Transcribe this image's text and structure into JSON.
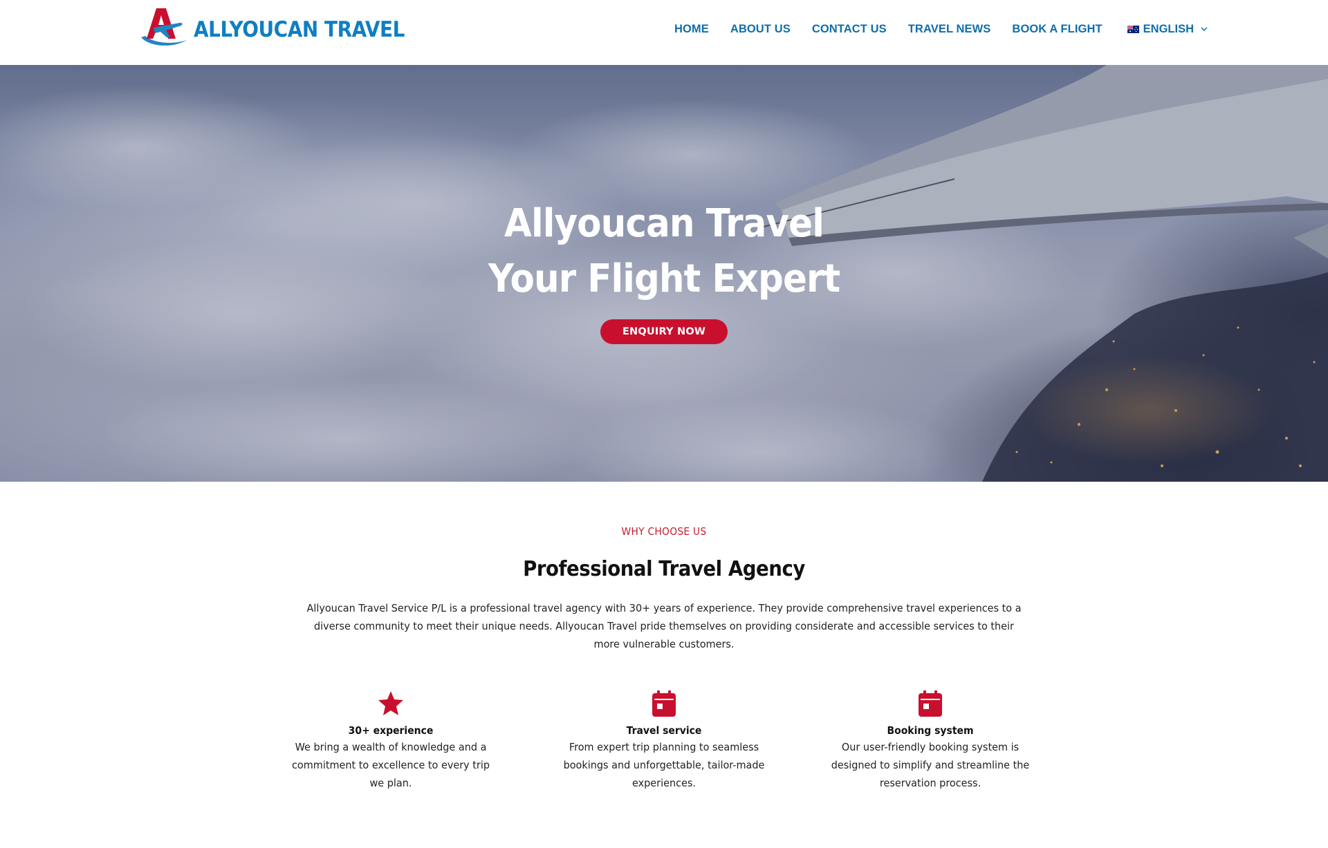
{
  "brand": {
    "name": "ALLYOUCAN TRAVEL",
    "logo_icon": "plane-a-logo-icon",
    "primary_color": "#0f7ec3",
    "accent_color": "#c8102e"
  },
  "nav": {
    "items": [
      {
        "label": "HOME"
      },
      {
        "label": "ABOUT US"
      },
      {
        "label": "CONTACT US"
      },
      {
        "label": "TRAVEL NEWS"
      },
      {
        "label": "BOOK A FLIGHT"
      }
    ],
    "language": {
      "label": "ENGLISH",
      "flag_icon": "australia-flag-icon"
    }
  },
  "hero": {
    "title_line1": "Allyoucan Travel",
    "title_line2": "Your Flight Expert",
    "cta_label": "ENQUIRY NOW"
  },
  "why": {
    "eyebrow": "WHY CHOOSE US",
    "title": "Professional Travel Agency",
    "intro": "Allyoucan Travel Service P/L is a professional travel agency with 30+ years of experience. They provide comprehensive travel experiences to a diverse community to meet their unique needs. Allyoucan Travel pride themselves on providing considerate and accessible services to their more vulnerable customers.",
    "features": [
      {
        "icon": "star-icon",
        "title": "30+ experience",
        "description": "We bring a wealth of knowledge and a commitment to excellence to every trip we plan."
      },
      {
        "icon": "calendar-icon",
        "title": "Travel service",
        "description": "From expert trip planning to seamless bookings and unforgettable, tailor-made experiences."
      },
      {
        "icon": "calendar-icon",
        "title": "Booking system",
        "description": "Our user-friendly booking system is designed to simplify and streamline the reservation process."
      }
    ]
  }
}
